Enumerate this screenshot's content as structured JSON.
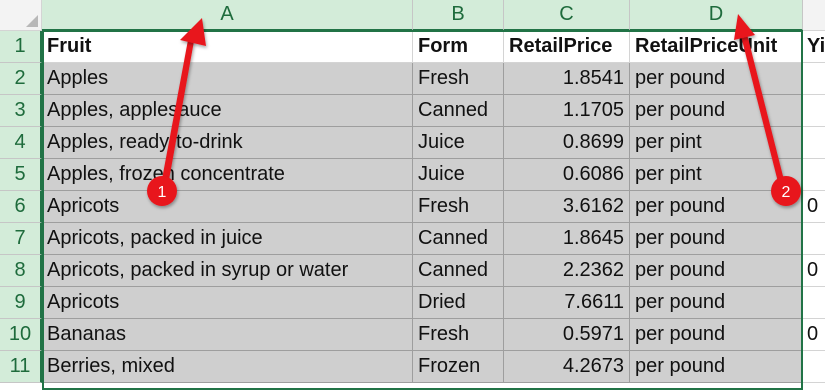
{
  "columns": [
    {
      "letter": "A"
    },
    {
      "letter": "B"
    },
    {
      "letter": "C"
    },
    {
      "letter": "D"
    }
  ],
  "extra_column_header": "Yi",
  "rows": [
    {
      "num": "1",
      "fruit": "Fruit",
      "form": "Form",
      "price": "RetailPrice",
      "unit": "RetailPriceUnit",
      "extra": "Yi"
    },
    {
      "num": "2",
      "fruit": "Apples",
      "form": "Fresh",
      "price": "1.8541",
      "unit": "per pound",
      "extra": ""
    },
    {
      "num": "3",
      "fruit": "Apples, applesauce",
      "form": "Canned",
      "price": "1.1705",
      "unit": "per pound",
      "extra": ""
    },
    {
      "num": "4",
      "fruit": "Apples, ready-to-drink",
      "form": "Juice",
      "price": "0.8699",
      "unit": "per pint",
      "extra": ""
    },
    {
      "num": "5",
      "fruit": "Apples, frozen concentrate",
      "form": "Juice",
      "price": "0.6086",
      "unit": "per pint",
      "extra": ""
    },
    {
      "num": "6",
      "fruit": "Apricots",
      "form": "Fresh",
      "price": "3.6162",
      "unit": "per pound",
      "extra": "0"
    },
    {
      "num": "7",
      "fruit": "Apricots, packed in juice",
      "form": "Canned",
      "price": "1.8645",
      "unit": "per pound",
      "extra": ""
    },
    {
      "num": "8",
      "fruit": "Apricots, packed in syrup or water",
      "form": "Canned",
      "price": "2.2362",
      "unit": "per pound",
      "extra": "0"
    },
    {
      "num": "9",
      "fruit": "Apricots",
      "form": "Dried",
      "price": "7.6611",
      "unit": "per pound",
      "extra": ""
    },
    {
      "num": "10",
      "fruit": "Bananas",
      "form": "Fresh",
      "price": "0.5971",
      "unit": "per pound",
      "extra": "0"
    },
    {
      "num": "11",
      "fruit": "Berries, mixed",
      "form": "Frozen",
      "price": "4.2673",
      "unit": "per pound",
      "extra": ""
    }
  ],
  "annotations": [
    {
      "label": "1",
      "color": "#e8141b"
    },
    {
      "label": "2",
      "color": "#e8141b"
    }
  ],
  "colors": {
    "selection_green": "#217346",
    "header_highlight": "#d3ecd9",
    "selected_cell": "#cfcfcf",
    "annotation_red": "#e8141b"
  }
}
